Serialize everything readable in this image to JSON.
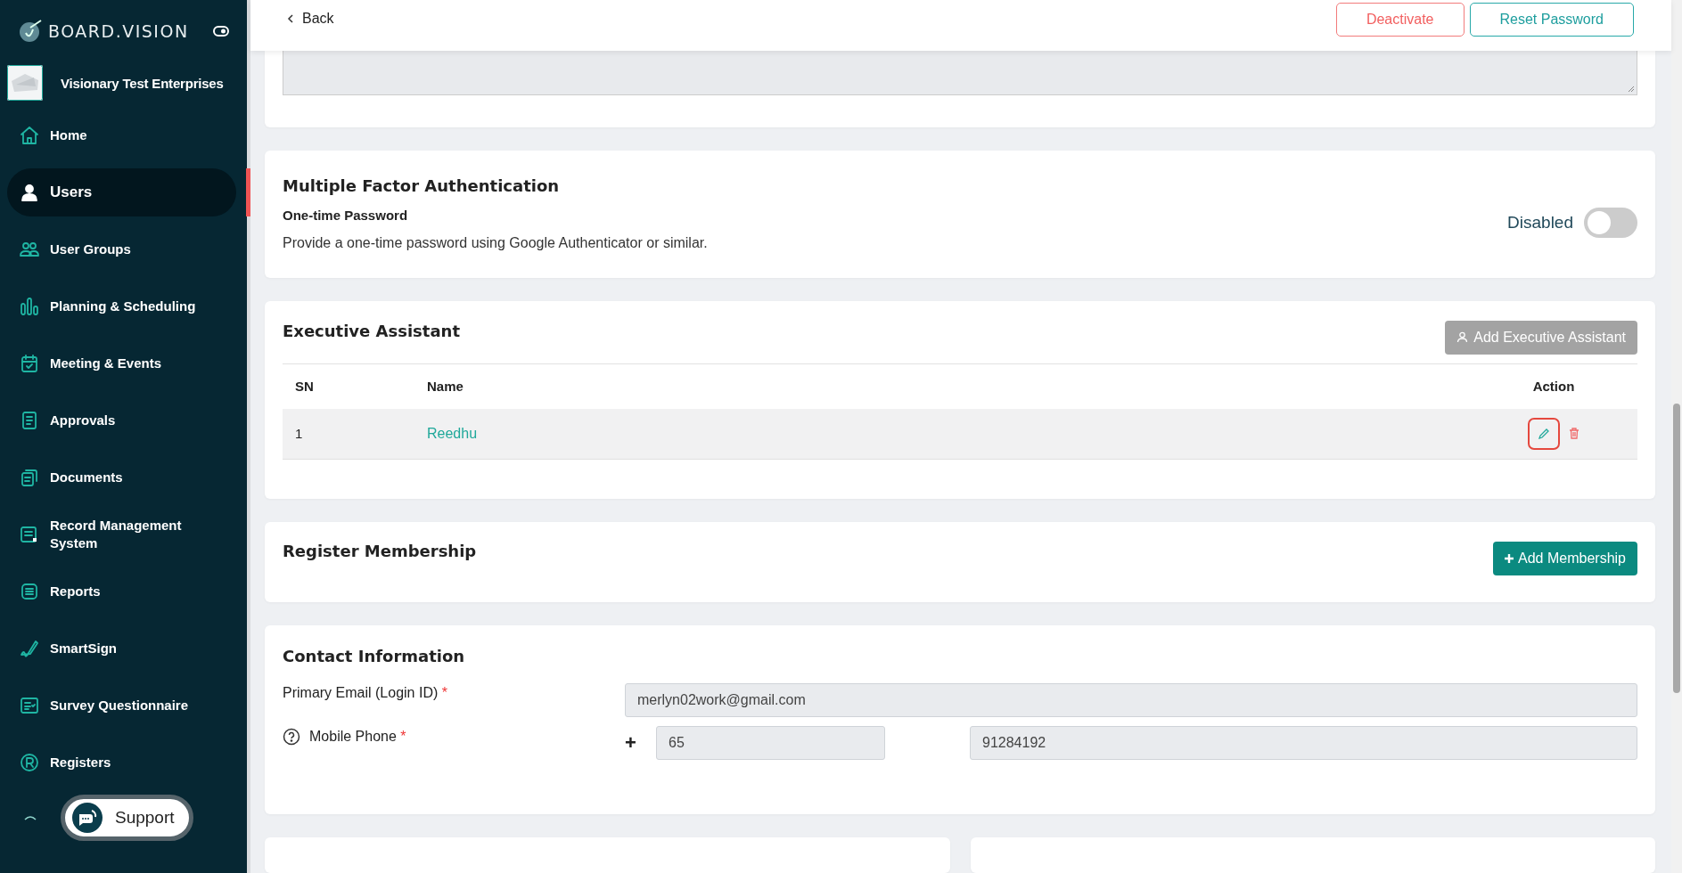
{
  "sidebar": {
    "brand": "BOARD.VISION",
    "organization": "Visionary Test Enterprises",
    "items": [
      {
        "label": "Home",
        "selected": false
      },
      {
        "label": "Users",
        "selected": true
      },
      {
        "label": "User Groups",
        "selected": false
      },
      {
        "label": "Planning & Scheduling",
        "selected": false
      },
      {
        "label": "Meeting & Events",
        "selected": false
      },
      {
        "label": "Approvals",
        "selected": false
      },
      {
        "label": "Documents",
        "selected": false
      },
      {
        "label": "Record Management System",
        "selected": false
      },
      {
        "label": "Reports",
        "selected": false
      },
      {
        "label": "SmartSign",
        "selected": false
      },
      {
        "label": "Survey Questionnaire",
        "selected": false
      },
      {
        "label": "Registers",
        "selected": false
      }
    ],
    "support": "Support"
  },
  "top_bar": {
    "back": "Back",
    "buttons": [
      {
        "label": "Deactivate",
        "kind": "danger"
      },
      {
        "label": "Reset Password",
        "kind": "primary"
      }
    ]
  },
  "mfa": {
    "title": "Multiple Factor Authentication",
    "subtitle": "One-time Password",
    "description": "Provide a one-time password using Google Authenticator or similar.",
    "status": "Disabled",
    "on": false
  },
  "executive_assistant": {
    "title": "Executive Assistant",
    "add_button": {
      "label": "Add Executive Assistant",
      "disabled": true
    },
    "columns": [
      "SN",
      "Name",
      "Action"
    ],
    "rows": [
      {
        "sn": "1",
        "name": "Reedhu",
        "edit_focused": true
      }
    ]
  },
  "membership": {
    "title": "Register Membership",
    "add_button": "Add Membership"
  },
  "contact": {
    "title": "Contact Information",
    "email": {
      "label": "Primary Email (Login ID)",
      "required_mark": "*",
      "value": "merlyn02work@gmail.com"
    },
    "phone": {
      "label": "Mobile Phone",
      "required_mark": "*",
      "plus": "+",
      "country_code": "65",
      "number": "91284192"
    }
  }
}
